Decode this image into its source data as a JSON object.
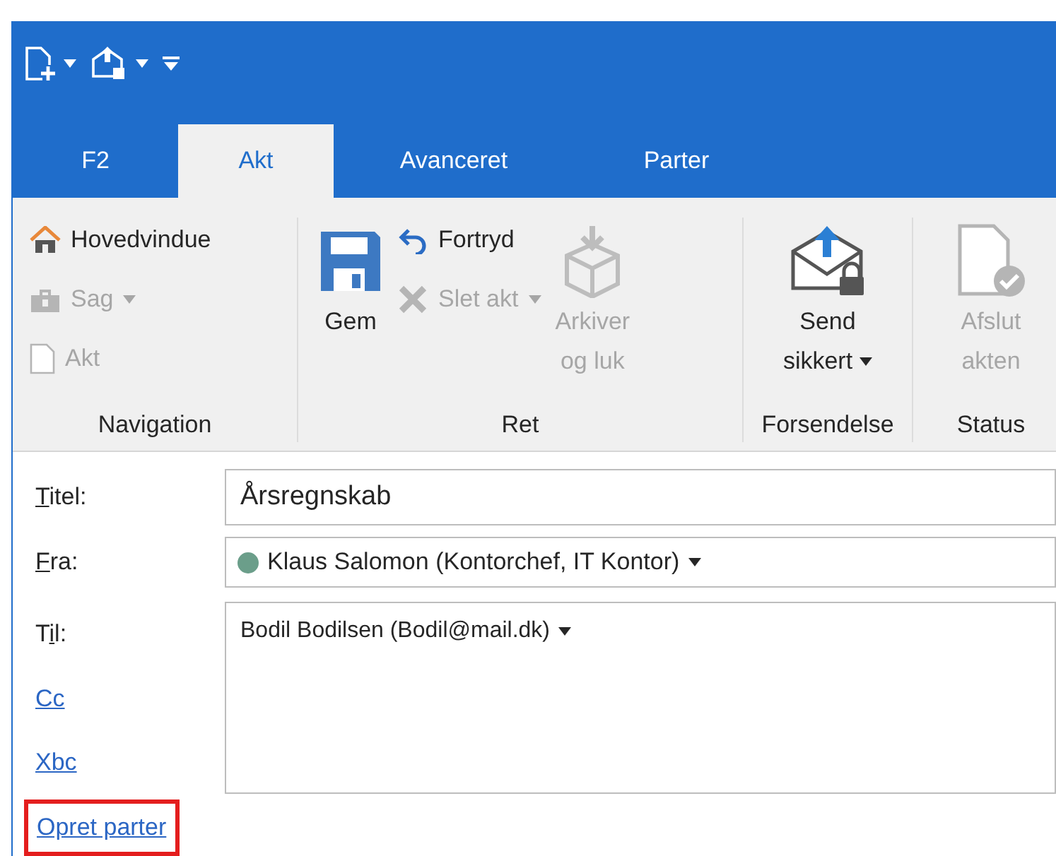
{
  "quick_access": {
    "buttons": [
      {
        "has_menu": true
      },
      {
        "has_menu": true
      }
    ]
  },
  "tabs": [
    {
      "label": "F2",
      "selected": false
    },
    {
      "label": "Akt",
      "selected": true
    },
    {
      "label": "Avanceret",
      "selected": false
    },
    {
      "label": "Parter",
      "selected": false
    }
  ],
  "ribbon": {
    "groups": [
      {
        "label": "Navigation",
        "columns": [
          {
            "kind": "stack",
            "items": [
              {
                "label": "Hovedvindue",
                "disabled": false,
                "has_menu": false
              },
              {
                "label": "Sag",
                "disabled": true,
                "has_menu": true
              },
              {
                "label": "Akt",
                "disabled": true,
                "has_menu": false
              }
            ]
          }
        ]
      },
      {
        "label": "Ret",
        "columns": [
          {
            "kind": "large",
            "lines": [
              "Gem"
            ],
            "disabled": false,
            "has_menu": false
          },
          {
            "kind": "stack",
            "items": [
              {
                "label": "Fortryd",
                "disabled": false,
                "has_menu": false
              },
              {
                "label": "Slet akt",
                "disabled": true,
                "has_menu": true
              }
            ]
          },
          {
            "kind": "large",
            "lines": [
              "Arkiver",
              "og luk"
            ],
            "disabled": true,
            "has_menu": false
          }
        ]
      },
      {
        "label": "Forsendelse",
        "columns": [
          {
            "kind": "large",
            "lines": [
              "Send",
              "sikkert"
            ],
            "disabled": false,
            "has_menu": true
          }
        ]
      },
      {
        "label": "Status",
        "columns": [
          {
            "kind": "large",
            "lines": [
              "Afslut",
              "akten"
            ],
            "disabled": true,
            "has_menu": false
          }
        ]
      }
    ]
  },
  "form": {
    "title": {
      "label": {
        "key": "T",
        "after": "itel:"
      },
      "value": "Årsregnskab"
    },
    "from": {
      "label": {
        "key": "F",
        "after": "ra:"
      },
      "value": "Klaus Salomon (Kontorchef, IT Kontor)"
    },
    "to": {
      "label": {
        "before": "T",
        "key": "i",
        "after": "l:"
      },
      "recipients": [
        "Bodil Bodilsen (Bodil@mail.dk)"
      ]
    },
    "links": [
      {
        "label": "Cc"
      },
      {
        "label": "Xbc"
      }
    ],
    "create_parties": {
      "label": "Opret parter",
      "highlighted": true
    }
  }
}
